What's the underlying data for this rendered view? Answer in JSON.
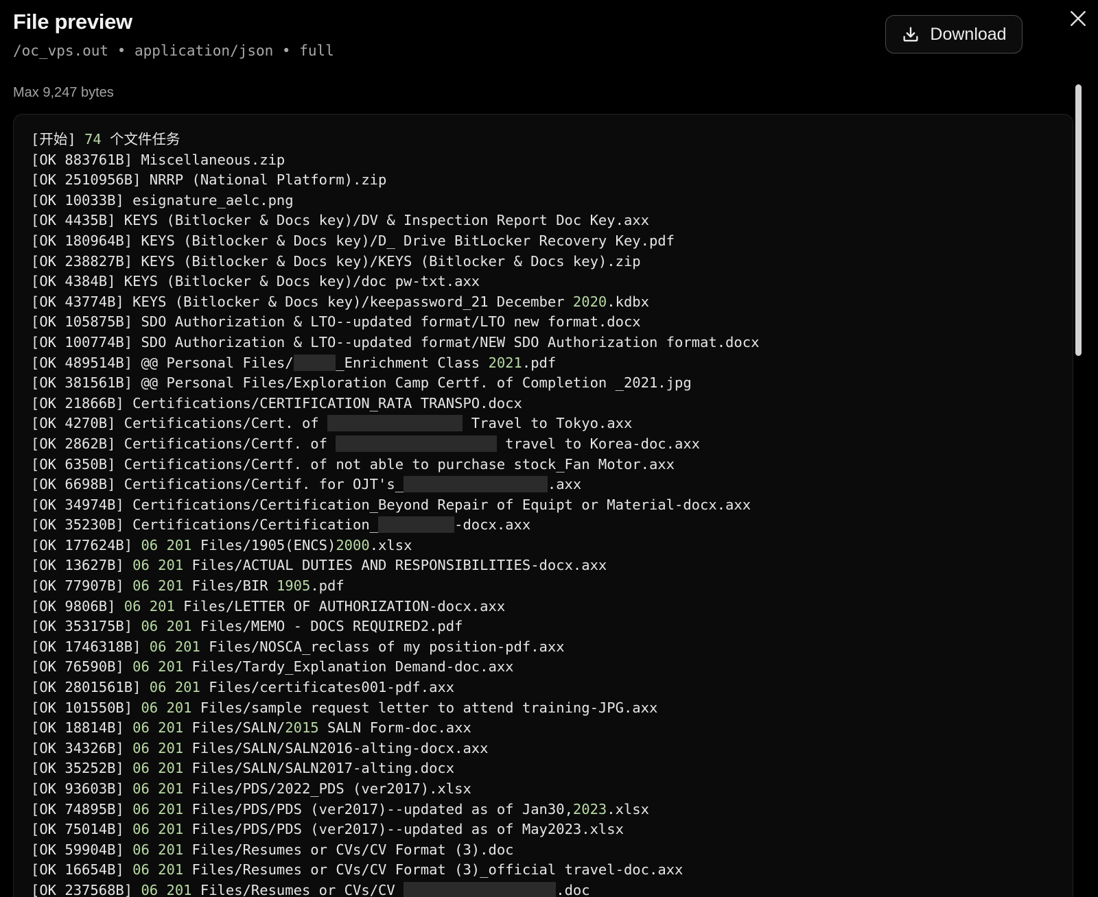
{
  "header": {
    "title": "File preview",
    "subtitle": "/oc_vps.out • application/json • full",
    "max_bytes": "Max 9,247 bytes",
    "download_label": "Download"
  },
  "lines": [
    [
      {
        "t": "[开始] "
      },
      {
        "t": "74",
        "c": "num"
      },
      {
        "t": " 个文件任务"
      }
    ],
    [
      {
        "t": "[OK 883761B] Miscellaneous.zip"
      }
    ],
    [
      {
        "t": "[OK 2510956B] NRRP (National Platform).zip"
      }
    ],
    [
      {
        "t": "[OK 10033B] esignature_aelc.png"
      }
    ],
    [
      {
        "t": "[OK 4435B] KEYS (Bitlocker & Docs key)/DV & Inspection Report Doc Key.axx"
      }
    ],
    [
      {
        "t": "[OK 180964B] KEYS (Bitlocker & Docs key)/D_ Drive BitLocker Recovery Key.pdf"
      }
    ],
    [
      {
        "t": "[OK 238827B] KEYS (Bitlocker & Docs key)/KEYS (Bitlocker & Docs key).zip"
      }
    ],
    [
      {
        "t": "[OK 4384B] KEYS (Bitlocker & Docs key)/doc pw-txt.axx"
      }
    ],
    [
      {
        "t": "[OK 43774B] KEYS (Bitlocker & Docs key)/keepassword_21 December "
      },
      {
        "t": "2020",
        "c": "num"
      },
      {
        "t": ".kdbx"
      }
    ],
    [
      {
        "t": "[OK 105875B] SDO Authorization & LTO--updated format/LTO new format.docx"
      }
    ],
    [
      {
        "t": "[OK 100774B] SDO Authorization & LTO--updated format/NEW SDO Authorization format.docx"
      }
    ],
    [
      {
        "t": "[OK 489514B] @@ Personal Files/"
      },
      {
        "r": 5
      },
      {
        "t": "_Enrichment Class "
      },
      {
        "t": "2021",
        "c": "num"
      },
      {
        "t": ".pdf"
      }
    ],
    [
      {
        "t": "[OK 381561B] @@ Personal Files/Exploration Camp Certf. of Completion _2021.jpg"
      }
    ],
    [
      {
        "t": "[OK 21866B] Certifications/CERTIFICATION_RATA TRANSPO.docx"
      }
    ],
    [
      {
        "t": "[OK 4270B] Certifications/Cert. of "
      },
      {
        "r": 16
      },
      {
        "t": " Travel to Tokyo.axx"
      }
    ],
    [
      {
        "t": "[OK 2862B] Certifications/Certf. of "
      },
      {
        "r": 19
      },
      {
        "t": " travel to Korea-doc.axx"
      }
    ],
    [
      {
        "t": "[OK 6350B] Certifications/Certf. of not able to purchase stock_Fan Motor.axx"
      }
    ],
    [
      {
        "t": "[OK 6698B] Certifications/Certif. for OJT's_"
      },
      {
        "r": 17
      },
      {
        "t": ".axx"
      }
    ],
    [
      {
        "t": "[OK 34974B] Certifications/Certification_Beyond Repair of Equipt or Material-docx.axx"
      }
    ],
    [
      {
        "t": "[OK 35230B] Certifications/Certification_"
      },
      {
        "r": 9
      },
      {
        "t": "-docx.axx"
      }
    ],
    [
      {
        "t": "[OK 177624B] "
      },
      {
        "t": "06 201",
        "c": "num"
      },
      {
        "t": " Files/1905(ENCS)"
      },
      {
        "t": "2000",
        "c": "num"
      },
      {
        "t": ".xlsx"
      }
    ],
    [
      {
        "t": "[OK 13627B] "
      },
      {
        "t": "06 201",
        "c": "num"
      },
      {
        "t": " Files/ACTUAL DUTIES AND RESPONSIBILITIES-docx.axx"
      }
    ],
    [
      {
        "t": "[OK 77907B] "
      },
      {
        "t": "06 201",
        "c": "num"
      },
      {
        "t": " Files/BIR "
      },
      {
        "t": "1905",
        "c": "num"
      },
      {
        "t": ".pdf"
      }
    ],
    [
      {
        "t": "[OK 9806B] "
      },
      {
        "t": "06 201",
        "c": "num"
      },
      {
        "t": " Files/LETTER OF AUTHORIZATION-docx.axx"
      }
    ],
    [
      {
        "t": "[OK 353175B] "
      },
      {
        "t": "06 201",
        "c": "num"
      },
      {
        "t": " Files/MEMO - DOCS REQUIRED2.pdf"
      }
    ],
    [
      {
        "t": "[OK 1746318B] "
      },
      {
        "t": "06 201",
        "c": "num"
      },
      {
        "t": " Files/NOSCA_reclass of my position-pdf.axx"
      }
    ],
    [
      {
        "t": "[OK 76590B] "
      },
      {
        "t": "06 201",
        "c": "num"
      },
      {
        "t": " Files/Tardy_Explanation Demand-doc.axx"
      }
    ],
    [
      {
        "t": "[OK 2801561B] "
      },
      {
        "t": "06 201",
        "c": "num"
      },
      {
        "t": " Files/certificates001-pdf.axx"
      }
    ],
    [
      {
        "t": "[OK 101550B] "
      },
      {
        "t": "06 201",
        "c": "num"
      },
      {
        "t": " Files/sample request letter to attend training-JPG.axx"
      }
    ],
    [
      {
        "t": "[OK 18814B] "
      },
      {
        "t": "06 201",
        "c": "num"
      },
      {
        "t": " Files/SALN/"
      },
      {
        "t": "2015",
        "c": "num"
      },
      {
        "t": " SALN Form-doc.axx"
      }
    ],
    [
      {
        "t": "[OK 34326B] "
      },
      {
        "t": "06 201",
        "c": "num"
      },
      {
        "t": " Files/SALN/SALN2016-alting-docx.axx"
      }
    ],
    [
      {
        "t": "[OK 35252B] "
      },
      {
        "t": "06 201",
        "c": "num"
      },
      {
        "t": " Files/SALN/SALN2017-alting.docx"
      }
    ],
    [
      {
        "t": "[OK 93603B] "
      },
      {
        "t": "06 201",
        "c": "num"
      },
      {
        "t": " Files/PDS/2022_PDS (ver2017).xlsx"
      }
    ],
    [
      {
        "t": "[OK 74895B] "
      },
      {
        "t": "06 201",
        "c": "num"
      },
      {
        "t": " Files/PDS/PDS (ver2017)--updated as of Jan30,"
      },
      {
        "t": "2023",
        "c": "num"
      },
      {
        "t": ".xlsx"
      }
    ],
    [
      {
        "t": "[OK 75014B] "
      },
      {
        "t": "06 201",
        "c": "num"
      },
      {
        "t": " Files/PDS/PDS (ver2017)--updated as of May2023.xlsx"
      }
    ],
    [
      {
        "t": "[OK 59904B] "
      },
      {
        "t": "06 201",
        "c": "num"
      },
      {
        "t": " Files/Resumes or CVs/CV Format (3).doc"
      }
    ],
    [
      {
        "t": "[OK 16654B] "
      },
      {
        "t": "06 201",
        "c": "num"
      },
      {
        "t": " Files/Resumes or CVs/CV Format (3)_official travel-doc.axx"
      }
    ],
    [
      {
        "t": "[OK 237568B] "
      },
      {
        "t": "06 201",
        "c": "num"
      },
      {
        "t": " Files/Resumes or CVs/CV_"
      },
      {
        "r": 18
      },
      {
        "t": ".doc"
      }
    ]
  ]
}
